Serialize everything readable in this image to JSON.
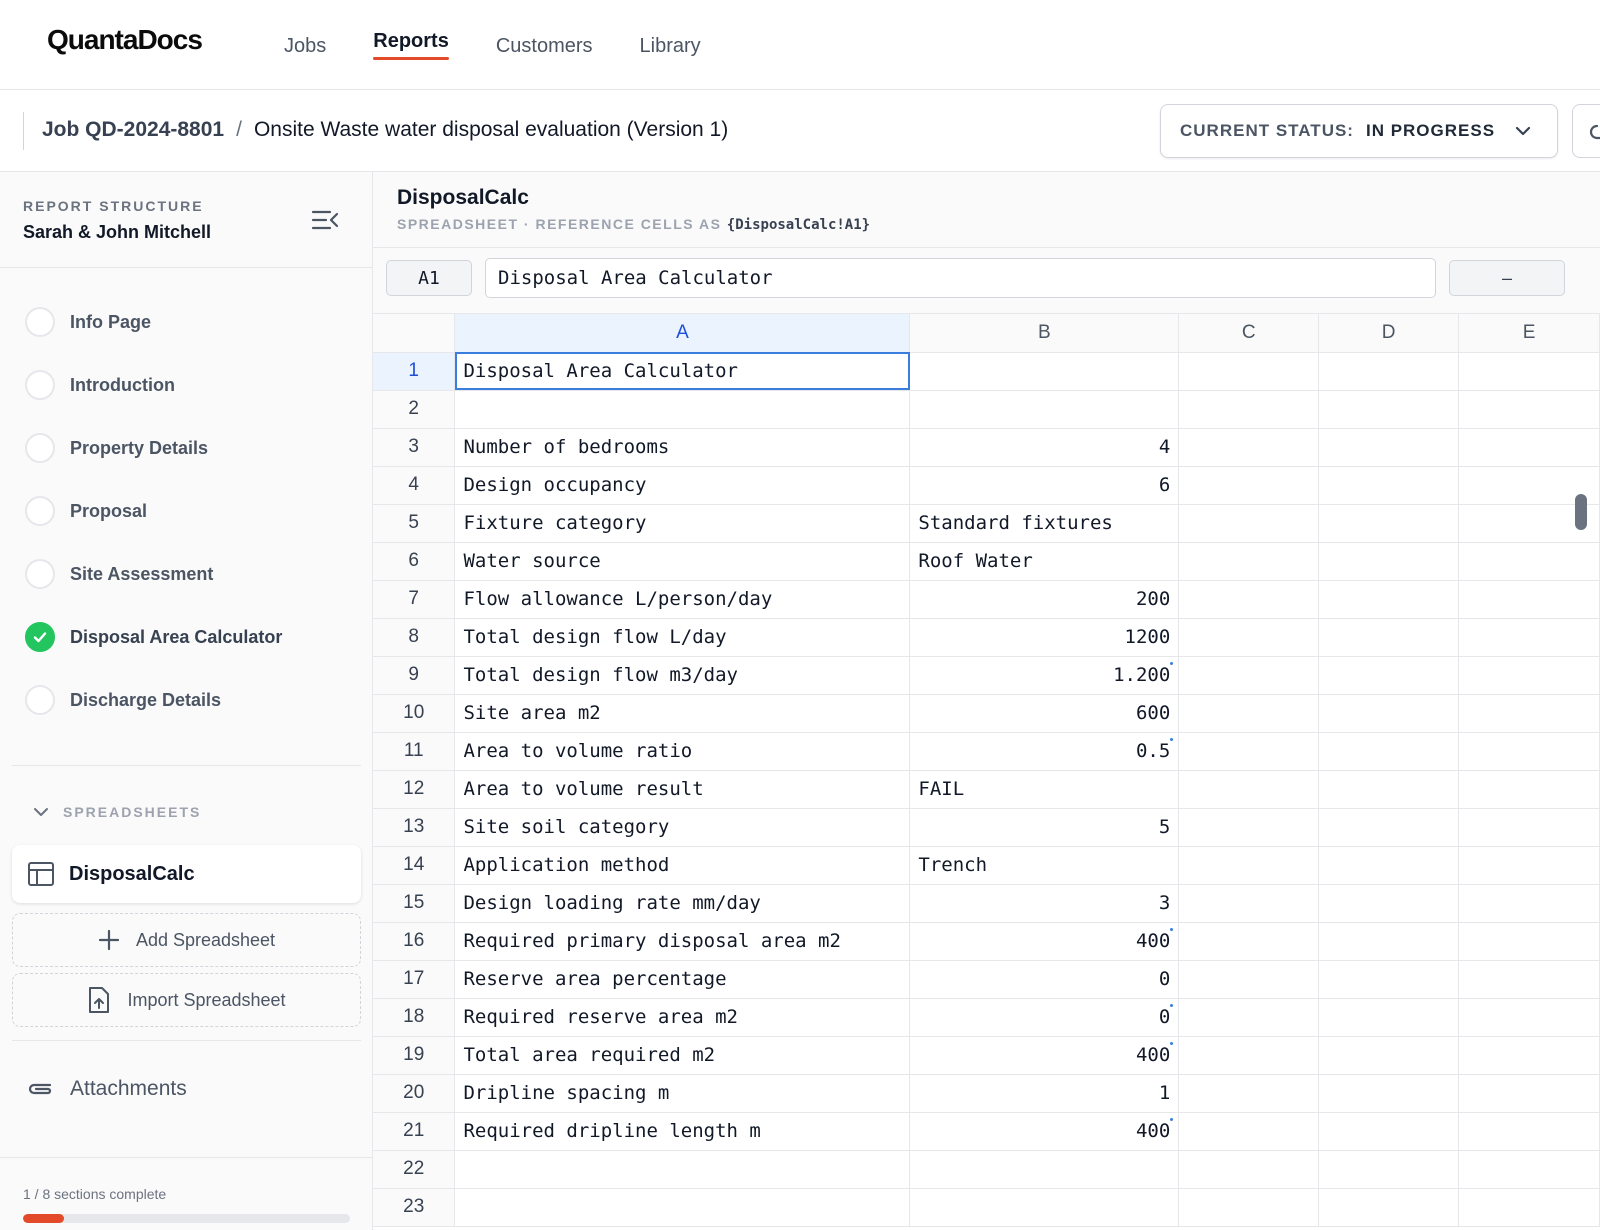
{
  "app": {
    "logo": "QuantaDocs",
    "nav": [
      {
        "label": "Jobs",
        "active": false
      },
      {
        "label": "Reports",
        "active": true
      },
      {
        "label": "Customers",
        "active": false
      },
      {
        "label": "Library",
        "active": false
      }
    ],
    "accent": "#e24a29"
  },
  "header": {
    "job": "Job QD-2024-8801",
    "sep": "/",
    "title": "Onsite Waste water disposal evaluation (Version 1)",
    "status_label": "CURRENT STATUS:",
    "status_value": "IN PROGRESS"
  },
  "sidebar": {
    "kicker": "REPORT STRUCTURE",
    "client": "Sarah & John Mitchell",
    "sections": [
      {
        "label": "Info Page",
        "done": false
      },
      {
        "label": "Introduction",
        "done": false
      },
      {
        "label": "Property Details",
        "done": false
      },
      {
        "label": "Proposal",
        "done": false
      },
      {
        "label": "Site Assessment",
        "done": false
      },
      {
        "label": "Disposal Area Calculator",
        "done": true
      },
      {
        "label": "Discharge Details",
        "done": false
      }
    ],
    "spreadsheets_heading": "SPREADSHEETS",
    "spreadsheets": [
      "DisposalCalc"
    ],
    "add_spreadsheet": "Add Spreadsheet",
    "import_spreadsheet": "Import Spreadsheet",
    "attachments": "Attachments",
    "progress_text": "1 / 8 sections complete",
    "progress_fraction": 0.125
  },
  "sheet": {
    "name": "DisposalCalc",
    "subtitle": "SPREADSHEET · REFERENCE CELLS AS ",
    "ref_hint": "{DisposalCalc!A1}",
    "cell_ref": "A1",
    "formula_value": "Disposal Area Calculator",
    "formula_btn": "–",
    "columns": [
      "A",
      "B",
      "C",
      "D",
      "E"
    ],
    "rows": [
      {
        "n": "1",
        "a": "Disposal Area Calculator",
        "b": "",
        "b_num": false
      },
      {
        "n": "2",
        "a": "",
        "b": "",
        "b_num": false
      },
      {
        "n": "3",
        "a": "Number of bedrooms",
        "b": "4",
        "b_num": true
      },
      {
        "n": "4",
        "a": "Design occupancy",
        "b": "6",
        "b_num": true
      },
      {
        "n": "5",
        "a": "Fixture category",
        "b": "Standard fixtures",
        "b_num": false
      },
      {
        "n": "6",
        "a": "Water source",
        "b": "Roof Water",
        "b_num": false
      },
      {
        "n": "7",
        "a": "Flow allowance L/person/day",
        "b": "200",
        "b_num": true
      },
      {
        "n": "8",
        "a": "Total design flow L/day",
        "b": "1200",
        "b_num": true
      },
      {
        "n": "9",
        "a": "Total design flow m3/day",
        "b": "1.200",
        "b_num": true,
        "formula": true
      },
      {
        "n": "10",
        "a": "Site area m2",
        "b": "600",
        "b_num": true
      },
      {
        "n": "11",
        "a": "Area to volume ratio",
        "b": "0.5",
        "b_num": true,
        "formula": true
      },
      {
        "n": "12",
        "a": "Area to volume result",
        "b": "FAIL",
        "b_num": false
      },
      {
        "n": "13",
        "a": "Site soil category",
        "b": "5",
        "b_num": true
      },
      {
        "n": "14",
        "a": "Application method",
        "b": "Trench",
        "b_num": false
      },
      {
        "n": "15",
        "a": "Design loading rate mm/day",
        "b": "3",
        "b_num": true
      },
      {
        "n": "16",
        "a": "Required primary disposal area m2",
        "b": "400",
        "b_num": true,
        "formula": true
      },
      {
        "n": "17",
        "a": "Reserve area percentage",
        "b": "0",
        "b_num": true
      },
      {
        "n": "18",
        "a": "Required reserve area m2",
        "b": "0",
        "b_num": true,
        "formula": true
      },
      {
        "n": "19",
        "a": "Total area required m2",
        "b": "400",
        "b_num": true,
        "formula": true
      },
      {
        "n": "20",
        "a": "Dripline spacing m",
        "b": "1",
        "b_num": true
      },
      {
        "n": "21",
        "a": "Required dripline length m",
        "b": "400",
        "b_num": true,
        "formula": true
      },
      {
        "n": "22",
        "a": "",
        "b": "",
        "b_num": false
      },
      {
        "n": "23",
        "a": "",
        "b": "",
        "b_num": false
      }
    ]
  }
}
